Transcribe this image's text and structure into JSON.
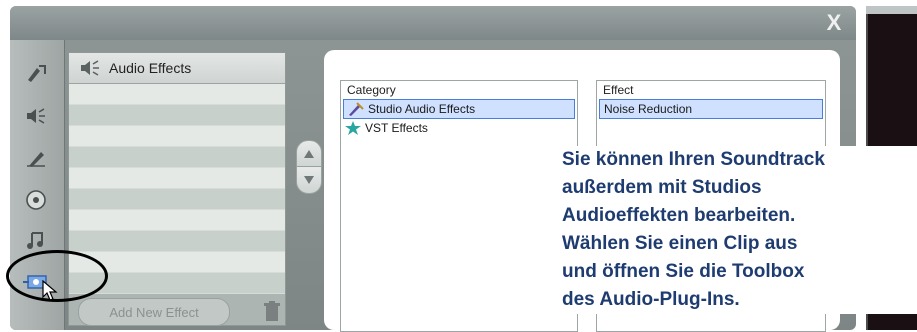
{
  "window": {
    "close_glyph": "X"
  },
  "sidebar": {
    "tools": [
      {
        "icon": "video-edit-icon"
      },
      {
        "icon": "speaker-icon"
      },
      {
        "icon": "brush-icon"
      },
      {
        "icon": "disc-icon"
      },
      {
        "icon": "music-note-icon"
      },
      {
        "icon": "audio-plugin-icon"
      }
    ]
  },
  "left_panel": {
    "header_label": "Audio Effects",
    "add_button_label": "Add New Effect"
  },
  "category_list": {
    "header": "Category",
    "items": [
      {
        "label": "Studio Audio Effects",
        "icon": "wrench-tools-icon",
        "selected": true
      },
      {
        "label": "VST Effects",
        "icon": "star-icon",
        "selected": false
      }
    ]
  },
  "effect_list": {
    "header": "Effect",
    "items": [
      {
        "label": "Noise Reduction",
        "selected": true
      }
    ]
  },
  "caption": {
    "lines": [
      "Sie können Ihren Soundtrack",
      "außerdem mit Studios",
      "Audioeffekten bearbeiten.",
      "Wählen Sie einen Clip aus",
      "und öffnen Sie die Toolbox",
      "des Audio-Plug-Ins."
    ]
  },
  "colors": {
    "window_bg": "#8a9292",
    "selection_bg": "#cfe1ff",
    "selection_border": "#4a7fd8",
    "caption_text": "#1f3c71"
  }
}
